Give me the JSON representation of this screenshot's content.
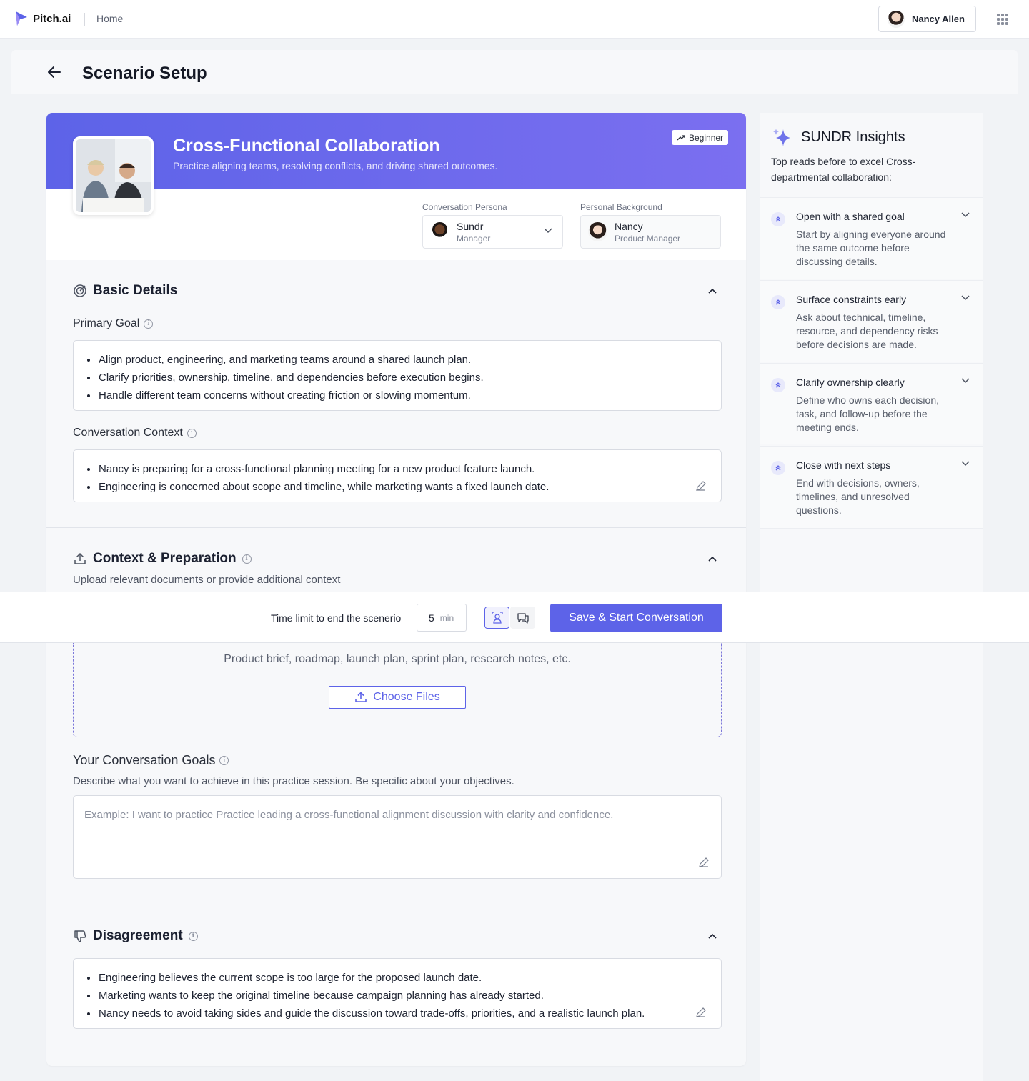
{
  "nav": {
    "brand": "Pitch.ai",
    "home": "Home",
    "user_name": "Nancy Allen"
  },
  "header": {
    "title": "Scenario Setup"
  },
  "scenario": {
    "title": "Cross-Functional Collaboration",
    "subtitle": "Practice aligning teams, resolving conflicts, and driving shared outcomes.",
    "level": "Beginner",
    "conversation_persona_label": "Conversation Persona",
    "persona_name": "Sundr",
    "persona_role": "Manager",
    "personal_background_label": "Personal Background",
    "background_name": "Nancy",
    "background_role": "Product Manager"
  },
  "basic_details": {
    "title": "Basic Details",
    "primary_goal_label": "Primary Goal",
    "primary_goal": [
      "Align product, engineering, and marketing teams around a shared launch plan.",
      "Clarify priorities, ownership, timeline, and dependencies before execution begins.",
      "Handle different team concerns without creating friction or slowing momentum."
    ],
    "context_label": "Conversation Context",
    "context": [
      "Nancy is preparing for a cross-functional planning meeting for a new product feature launch.",
      "Engineering is concerned about scope and timeline, while marketing wants a fixed launch date."
    ]
  },
  "context_prep": {
    "title": "Context & Preparation",
    "subtitle": "Upload relevant documents or provide additional context",
    "upload_hint": "Product brief, roadmap, launch plan, sprint plan, research notes, etc.",
    "choose_files": "Choose Files",
    "goals_label": "Your Conversation Goals",
    "goals_desc": "Describe what you want to achieve in this practice session. Be specific about your objectives.",
    "goals_placeholder": "Example: I want to practice Practice leading a cross-functional alignment discussion with clarity and confidence."
  },
  "disagreement": {
    "title": "Disagreement",
    "items": [
      "Engineering believes the current scope is too large for the proposed launch date.",
      "Marketing wants to keep the original timeline because campaign planning has already started.",
      "Nancy needs to avoid taking sides and guide the discussion toward trade-offs, priorities, and a realistic launch plan."
    ]
  },
  "insights": {
    "title": "SUNDR Insights",
    "subtitle": "Top reads before to excel  Cross-departmental collaboration:",
    "items": [
      {
        "title": "Open with a shared goal",
        "desc": "Start by aligning everyone around the same outcome before discussing details."
      },
      {
        "title": "Surface constraints early",
        "desc": "Ask about technical, timeline, resource, and dependency risks before decisions are made."
      },
      {
        "title": "Clarify ownership clearly",
        "desc": "Define who owns each decision, task, and follow-up before the meeting ends."
      },
      {
        "title": "Close with next steps",
        "desc": "End with decisions, owners, timelines, and unresolved questions."
      }
    ]
  },
  "action_bar": {
    "time_label": "Time limit to end the scenerio",
    "time_value": "5",
    "time_unit": "min",
    "save_label": "Save & Start Conversation"
  },
  "colors": {
    "accent": "#5d63e8",
    "banner_end": "#7b6ff0"
  }
}
